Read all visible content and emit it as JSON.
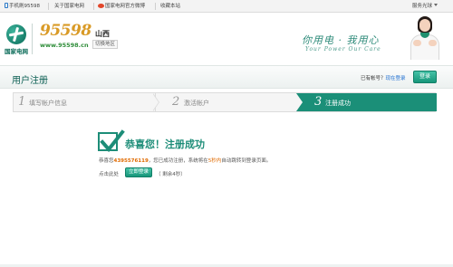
{
  "topbar": {
    "mobile": "手机刷95598",
    "about": "关于国家电网",
    "weibo": "国家电网官方微博",
    "bookmark": "收藏本站",
    "service_navigation": "服务光球"
  },
  "header": {
    "logo_text": "国家电网",
    "brand_number": "95598",
    "brand_url": "www.95598.cn",
    "region": "山西",
    "switch_region": "切换地区",
    "slogan_cn": "你用电 · 我用心",
    "slogan_en": "Your Power  Our Care"
  },
  "title_bar": {
    "title": "用户注册",
    "has_account": "已有帐号？",
    "login_now": "现在登录",
    "login_button": "登录"
  },
  "steps": [
    {
      "number": "1",
      "label": "填写帐户信息",
      "active": false
    },
    {
      "number": "2",
      "label": "激活帐户",
      "active": false
    },
    {
      "number": "3",
      "label": "注册成功",
      "active": true
    }
  ],
  "success": {
    "title": "恭喜您！注册成功",
    "msg_prefix": "恭喜您",
    "account_number": "4395576119",
    "msg_middle": "，您已成功注册，系统将在",
    "seconds": "5秒内",
    "msg_suffix": "自动跳转到登录页面。",
    "click_here": "点击此处",
    "go_login": "立即登录",
    "countdown": "（ 剩余4秒）"
  },
  "colors": {
    "brand_green": "#1b8f78",
    "brand_orange": "#d99a26",
    "link_blue": "#1f6fd1",
    "highlight_orange": "#e06a00"
  }
}
